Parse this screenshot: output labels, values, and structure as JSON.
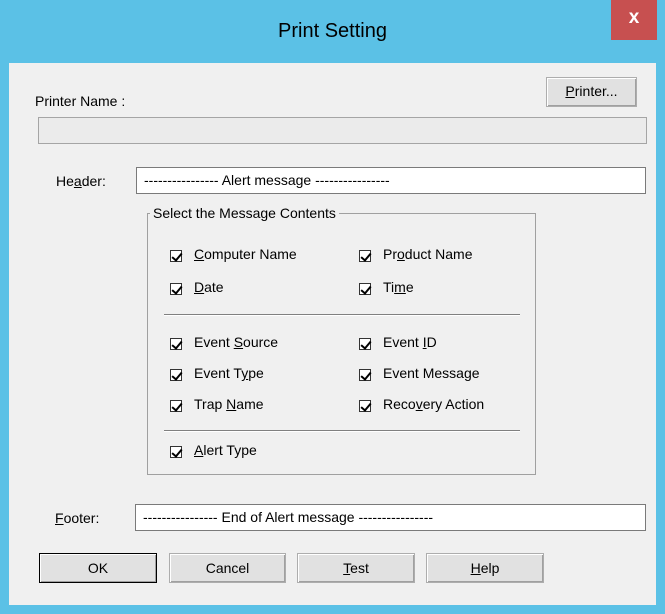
{
  "window": {
    "title": "Print Setting",
    "close_label": "x"
  },
  "printer": {
    "name_label": "Printer Name :",
    "button_label": "Printer...",
    "name_value": ""
  },
  "header": {
    "label": "Header:",
    "value": "---------------- Alert message ----------------"
  },
  "footer": {
    "label": "Footer:",
    "value": "---------------- End of Alert message ----------------"
  },
  "contents": {
    "legend": "Select the Message Contents",
    "computer_name": {
      "label": "Computer Name",
      "checked": true
    },
    "product_name": {
      "label": "Product Name",
      "checked": true
    },
    "date": {
      "label": "Date",
      "checked": true
    },
    "time": {
      "label": "Time",
      "checked": true
    },
    "event_source": {
      "label": "Event Source",
      "checked": true
    },
    "event_id": {
      "label": "Event ID",
      "checked": true
    },
    "event_type": {
      "label": "Event Type",
      "checked": true
    },
    "event_message": {
      "label": "Event Message",
      "checked": true
    },
    "trap_name": {
      "label": "Trap Name",
      "checked": true
    },
    "recovery_action": {
      "label": "Recovery Action",
      "checked": true
    },
    "alert_type": {
      "label": "Alert Type",
      "checked": true
    }
  },
  "buttons": {
    "ok": "OK",
    "cancel": "Cancel",
    "test": "Test",
    "help": "Help"
  }
}
